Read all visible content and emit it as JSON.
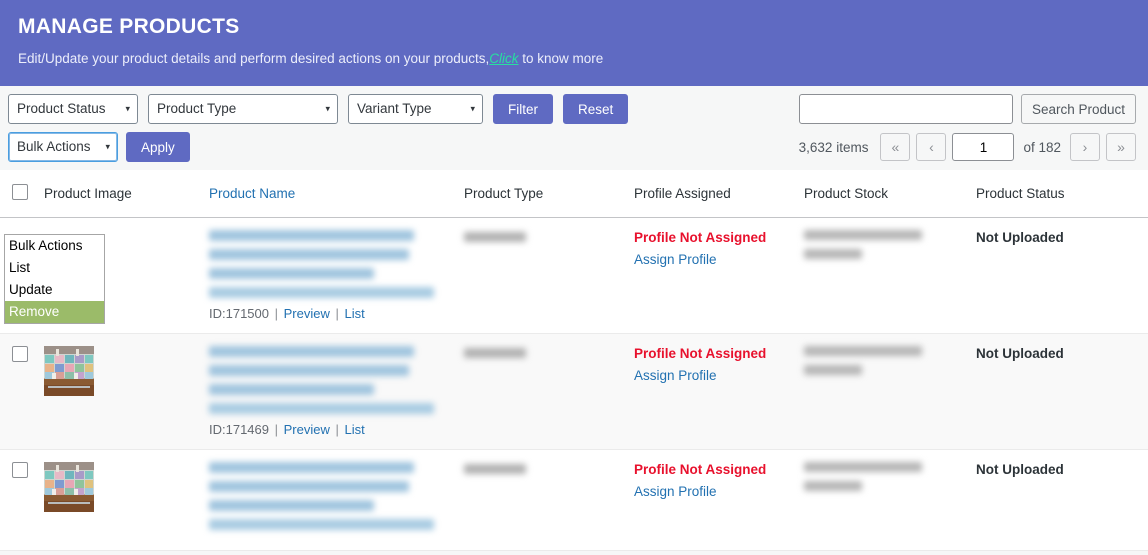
{
  "banner": {
    "title": "MANAGE PRODUCTS",
    "subtitle_before": "Edit/Update your product details and perform desired actions on your products,",
    "subtitle_link": "Click",
    "subtitle_after": " to know more",
    "bg_color": "#5f6ac2",
    "link_color": "#27e0a0"
  },
  "toolbar": {
    "product_status_label": "Product Status",
    "product_type_label": "Product Type",
    "variant_type_label": "Variant Type",
    "filter_label": "Filter",
    "reset_label": "Reset",
    "bulk_actions_label": "Bulk Actions",
    "apply_label": "Apply",
    "caret_glyph": "▾"
  },
  "bulk_dropdown": {
    "open": true,
    "options": [
      "Bulk Actions",
      "List",
      "Update",
      "Remove"
    ],
    "selected": "Remove",
    "highlight_color": "#9bbb69"
  },
  "search": {
    "value": "",
    "placeholder": "",
    "button_label": "Search Product"
  },
  "pagination": {
    "items_text": "3,632 items",
    "first_glyph": "«",
    "prev_glyph": "‹",
    "current_page": "1",
    "of_text": "of 182",
    "next_glyph": "›",
    "last_glyph": "»"
  },
  "table": {
    "headers": {
      "product_image": "Product Image",
      "product_name": "Product Name",
      "product_type": "Product Type",
      "profile_assigned": "Profile Assigned",
      "product_stock": "Product Stock",
      "product_status": "Product Status"
    },
    "sorted_column": "Product Name",
    "rows": [
      {
        "has_thumb": false,
        "name_redacted": true,
        "id_label": "ID:171500",
        "preview_label": "Preview",
        "list_label": "List",
        "type_redacted": true,
        "profile_status": "Profile Not Assigned",
        "profile_action": "Assign Profile",
        "stock_redacted": true,
        "product_status": "Not Uploaded"
      },
      {
        "has_thumb": true,
        "name_redacted": true,
        "id_label": "ID:171469",
        "preview_label": "Preview",
        "list_label": "List",
        "type_redacted": true,
        "profile_status": "Profile Not Assigned",
        "profile_action": "Assign Profile",
        "stock_redacted": true,
        "product_status": "Not Uploaded"
      },
      {
        "has_thumb": true,
        "name_redacted": true,
        "id_label": "",
        "preview_label": "",
        "list_label": "",
        "type_redacted": true,
        "profile_status": "Profile Not Assigned",
        "profile_action": "Assign Profile",
        "stock_redacted": true,
        "product_status": "Not Uploaded"
      }
    ]
  },
  "colors": {
    "accent": "#5f6ac2",
    "link": "#2271b1",
    "danger": "#e8112d",
    "row_alt": "#f9f9f9"
  }
}
